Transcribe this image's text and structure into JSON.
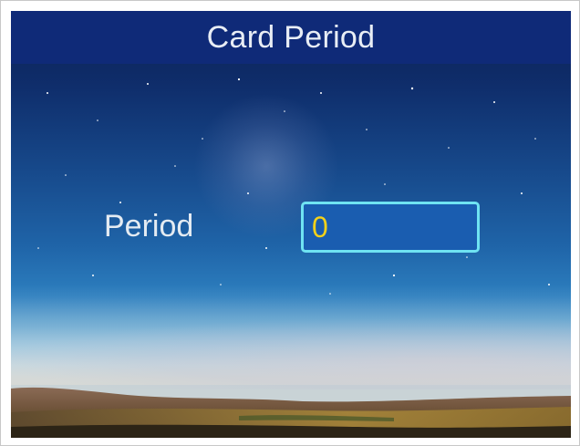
{
  "header": {
    "title": "Card Period"
  },
  "form": {
    "period_label": "Period",
    "period_value": "0"
  },
  "colors": {
    "header_bg": "#0f2a78",
    "input_border": "#6fe3f2",
    "input_text": "#f2d11a",
    "label_text": "#e4ebf2"
  }
}
